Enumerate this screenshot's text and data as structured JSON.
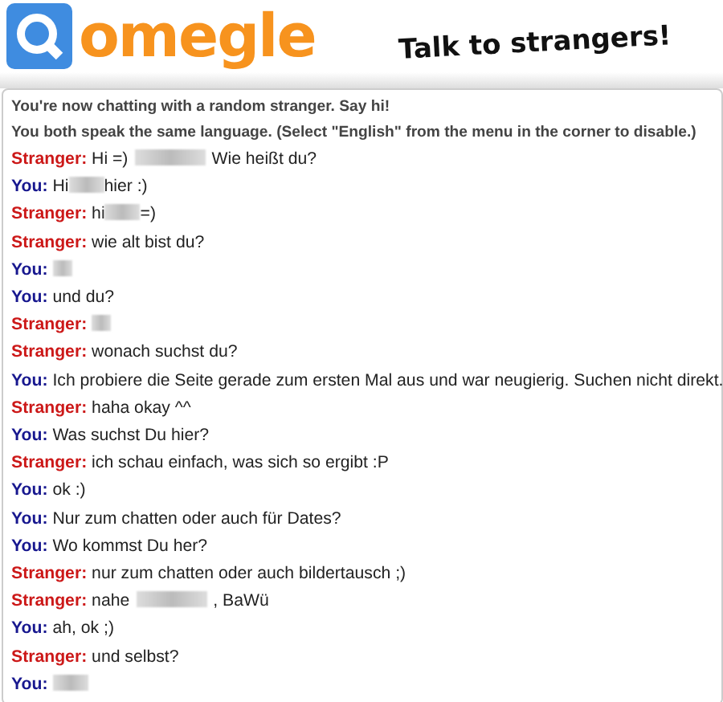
{
  "header": {
    "logo_text": "omegle",
    "tagline": "Talk to strangers!"
  },
  "system_messages": [
    "You're now chatting with a random stranger. Say hi!",
    "You both speak the same language. (Select \"English\" from the menu in the corner to disable.)"
  ],
  "messages": [
    {
      "kind": "stranger",
      "label": "Stranger:",
      "segments": [
        {
          "kind": "text",
          "text": "Hi =)"
        },
        {
          "kind": "blur"
        },
        {
          "kind": "text",
          "text": "Wie heißt du?"
        }
      ]
    },
    {
      "kind": "you",
      "label": "You:",
      "segments": [
        {
          "kind": "text",
          "text": "Hi"
        },
        {
          "kind": "blur-short"
        },
        {
          "kind": "text",
          "text": "hier :)"
        }
      ]
    },
    {
      "kind": "stranger",
      "label": "Stranger:",
      "segments": [
        {
          "kind": "text",
          "text": "hi"
        },
        {
          "kind": "blur-short"
        },
        {
          "kind": "text",
          "text": "=)"
        }
      ]
    },
    {
      "kind": "stranger",
      "label": "Stranger:",
      "segments": [
        {
          "kind": "text",
          "text": "wie alt bist du?"
        }
      ]
    },
    {
      "kind": "you",
      "label": "You:",
      "segments": [
        {
          "kind": "blur-tiny"
        }
      ]
    },
    {
      "kind": "you",
      "label": "You:",
      "segments": [
        {
          "kind": "text",
          "text": "und du?"
        }
      ]
    },
    {
      "kind": "stranger",
      "label": "Stranger:",
      "segments": [
        {
          "kind": "blur-tiny"
        }
      ]
    },
    {
      "kind": "stranger",
      "label": "Stranger:",
      "segments": [
        {
          "kind": "text",
          "text": "wonach suchst du?"
        }
      ]
    },
    {
      "kind": "you",
      "label": "You:",
      "segments": [
        {
          "kind": "text",
          "text": "Ich probiere die Seite gerade zum ersten Mal aus und war neugierig. Suchen nicht direkt."
        }
      ]
    },
    {
      "kind": "stranger",
      "label": "Stranger:",
      "segments": [
        {
          "kind": "text",
          "text": "haha okay ^^"
        }
      ]
    },
    {
      "kind": "you",
      "label": "You:",
      "segments": [
        {
          "kind": "text",
          "text": "Was suchst Du hier?"
        }
      ]
    },
    {
      "kind": "stranger",
      "label": "Stranger:",
      "segments": [
        {
          "kind": "text",
          "text": "ich schau einfach, was sich so ergibt :P"
        }
      ]
    },
    {
      "kind": "you",
      "label": "You:",
      "segments": [
        {
          "kind": "text",
          "text": "ok :)"
        }
      ]
    },
    {
      "kind": "you",
      "label": "You:",
      "segments": [
        {
          "kind": "text",
          "text": "Nur zum chatten oder auch für Dates?"
        }
      ]
    },
    {
      "kind": "you",
      "label": "You:",
      "segments": [
        {
          "kind": "text",
          "text": "Wo kommst Du her?"
        }
      ]
    },
    {
      "kind": "stranger",
      "label": "Stranger:",
      "segments": [
        {
          "kind": "text",
          "text": "nur zum chatten oder auch bildertausch ;)"
        }
      ]
    },
    {
      "kind": "stranger",
      "label": "Stranger:",
      "segments": [
        {
          "kind": "text",
          "text": "nahe"
        },
        {
          "kind": "blur"
        },
        {
          "kind": "text",
          "text": ", BaWü"
        }
      ]
    },
    {
      "kind": "you",
      "label": "You:",
      "segments": [
        {
          "kind": "text",
          "text": "ah, ok ;)"
        }
      ]
    },
    {
      "kind": "stranger",
      "label": "Stranger:",
      "segments": [
        {
          "kind": "text",
          "text": "und selbst?"
        }
      ]
    },
    {
      "kind": "you",
      "label": "You:",
      "segments": [
        {
          "kind": "blur-short"
        }
      ]
    }
  ]
}
